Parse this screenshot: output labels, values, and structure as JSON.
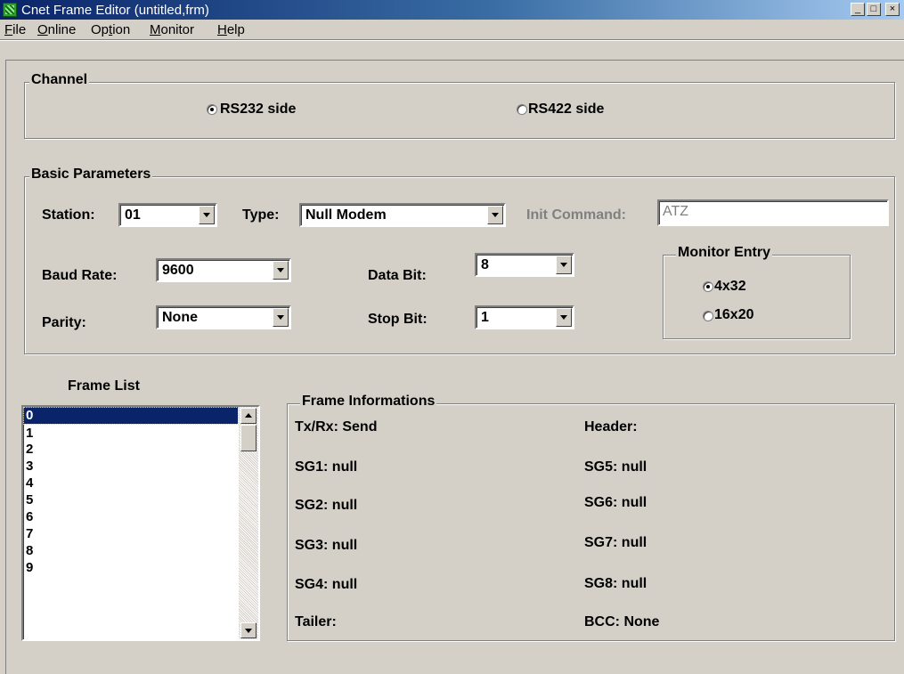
{
  "window": {
    "title": "Cnet Frame Editor (untitled,frm)",
    "buttons": {
      "minimize": "_",
      "maximize": "□",
      "close": "×"
    }
  },
  "menu": [
    {
      "key": "F",
      "rest": "ile"
    },
    {
      "key": "O",
      "rest": "nline"
    },
    {
      "pre": "Op",
      "key": "t",
      "rest": "ion"
    },
    {
      "key": "M",
      "rest": "onitor"
    },
    {
      "key": "H",
      "rest": "elp"
    }
  ],
  "channel": {
    "title": "Channel",
    "options": [
      {
        "label": "RS232 side",
        "selected": true
      },
      {
        "label": "RS422 side",
        "selected": false
      }
    ]
  },
  "basic": {
    "title": "Basic Parameters",
    "station": {
      "label": "Station:",
      "value": "01"
    },
    "type": {
      "label": "Type:",
      "value": "Null Modem"
    },
    "init": {
      "label": "Init Command:",
      "value": "ATZ",
      "disabled": true
    },
    "baud": {
      "label": "Baud Rate:",
      "value": "9600"
    },
    "databit": {
      "label": "Data Bit:",
      "value": "8"
    },
    "parity": {
      "label": "Parity:",
      "value": "None"
    },
    "stopbit": {
      "label": "Stop Bit:",
      "value": "1"
    },
    "monitor": {
      "title": "Monitor Entry",
      "options": [
        {
          "label": "4x32",
          "selected": true
        },
        {
          "label": "16x20",
          "selected": false
        }
      ]
    }
  },
  "frame_list": {
    "title": "Frame List",
    "items": [
      "0",
      "1",
      "2",
      "3",
      "4",
      "5",
      "6",
      "7",
      "8",
      "9"
    ],
    "selected_index": 0
  },
  "frame_info": {
    "title": "Frame Informations",
    "left": [
      "Tx/Rx: Send",
      "SG1: null",
      "SG2: null",
      "SG3: null",
      "SG4: null",
      "Tailer:"
    ],
    "right": [
      "Header:",
      "SG5: null",
      "SG6: null",
      "SG7: null",
      "SG8: null",
      "BCC: None"
    ]
  },
  "colors": {
    "title_active": "#0a246a",
    "face": "#d4d0c8",
    "selection": "#0a246a",
    "disabled_text": "#808080"
  }
}
